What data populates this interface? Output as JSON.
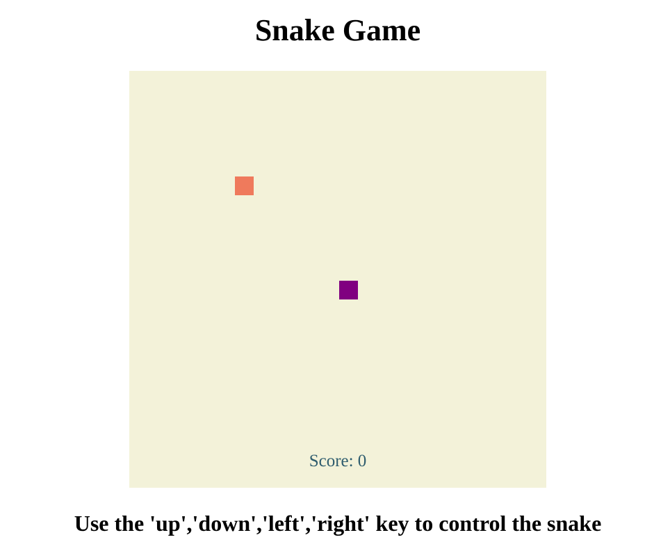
{
  "title": "Snake Game",
  "board": {
    "columns": 20,
    "rows": 20,
    "background_color": "#f3f2d9",
    "food": {
      "col": 5,
      "row": 5,
      "color": "#ef7a5c"
    },
    "snake": {
      "cells": [
        {
          "col": 10,
          "row": 10
        }
      ],
      "color": "#800080"
    },
    "score_label": "Score: 0",
    "score_color": "#2f5d6e"
  },
  "instructions": "Use the 'up','down','left','right' key to control the snake"
}
